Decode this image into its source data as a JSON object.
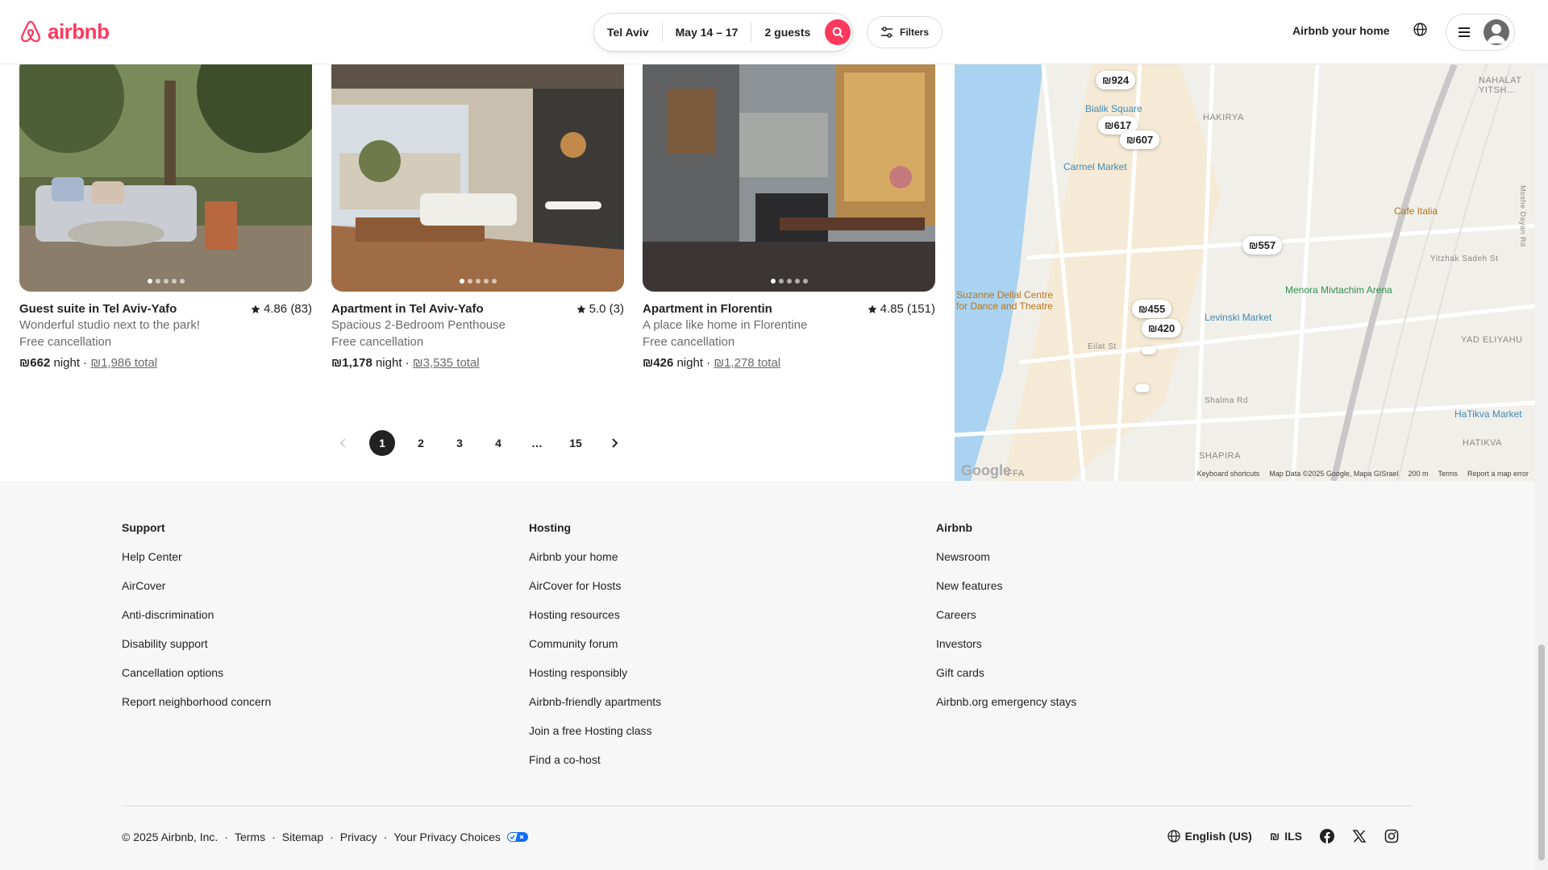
{
  "header": {
    "logo_text": "airbnb",
    "search": {
      "location": "Tel Aviv",
      "dates": "May 14 – 17",
      "guests": "2 guests"
    },
    "filters_label": "Filters",
    "host_link": "Airbnb your home",
    "brand_color": "#ff385c"
  },
  "listings": [
    {
      "title": "Guest suite in Tel Aviv-Yafo",
      "rating": "4.86 (83)",
      "subtitle": "Wonderful studio next to the park!",
      "cancellation": "Free cancellation",
      "price": "₪662",
      "price_unit": "night",
      "separator": "·",
      "total": "₪1,986 total"
    },
    {
      "title": "Apartment in Tel Aviv-Yafo",
      "rating": "5.0 (3)",
      "subtitle": "Spacious 2-Bedroom Penthouse",
      "cancellation": "Free cancellation",
      "price": "₪1,178",
      "price_unit": "night",
      "separator": "·",
      "total": "₪3,535 total"
    },
    {
      "title": "Apartment in Florentin",
      "rating": "4.85 (151)",
      "subtitle": "A place like home in Florentine",
      "cancellation": "Free cancellation",
      "price": "₪426",
      "price_unit": "night",
      "separator": "·",
      "total": "₪1,278 total"
    }
  ],
  "pagination": {
    "pages": [
      "1",
      "2",
      "3",
      "4",
      "…",
      "15"
    ],
    "current": "1"
  },
  "map": {
    "pins": [
      "₪924",
      "₪617",
      "₪607",
      "₪557",
      "₪455",
      "₪420"
    ],
    "labels": {
      "bialik": "Bialik Square",
      "carmel": "Carmel Market",
      "hakirya": "HAKIRYA",
      "nahalat": "NAHALAT YITSH...",
      "cafe": "Cafe Italia",
      "yitzhak": "Yitzhak Sadeh St",
      "menora": "Menora Mivtachim Arena",
      "suzanne1": "Suzanne Dellal Centre",
      "suzanne2": "for Dance and Theatre",
      "levinski": "Levinski Market",
      "yad": "YAD ELIYAHU",
      "eilat": "Eilat St",
      "shalma": "Shalma Rd",
      "hatikva_market": "HaTikva Market",
      "hatikva": "HATIKVA",
      "shapira": "SHAPIRA",
      "yafo": "FFA",
      "road_right": "Moshe Dayan Rd"
    },
    "google": "Google",
    "footer": {
      "shortcuts": "Keyboard shortcuts",
      "data": "Map Data ©2025 Google, Mapa GISrael",
      "scale": "200 m",
      "terms": "Terms",
      "report": "Report a map error"
    }
  },
  "footer": {
    "support": {
      "heading": "Support",
      "links": [
        "Help Center",
        "AirCover",
        "Anti-discrimination",
        "Disability support",
        "Cancellation options",
        "Report neighborhood concern"
      ]
    },
    "hosting": {
      "heading": "Hosting",
      "links": [
        "Airbnb your home",
        "AirCover for Hosts",
        "Hosting resources",
        "Community forum",
        "Hosting responsibly",
        "Airbnb-friendly apartments",
        "Join a free Hosting class",
        "Find a co-host"
      ]
    },
    "airbnb": {
      "heading": "Airbnb",
      "links": [
        "Newsroom",
        "New features",
        "Careers",
        "Investors",
        "Gift cards",
        "Airbnb.org emergency stays"
      ]
    },
    "copyright": "© 2025 Airbnb, Inc.",
    "bottom_links": [
      "Terms",
      "Sitemap",
      "Privacy",
      "Your Privacy Choices"
    ],
    "dot": "·",
    "language": "English (US)",
    "currency_symbol": "₪",
    "currency": "ILS"
  }
}
